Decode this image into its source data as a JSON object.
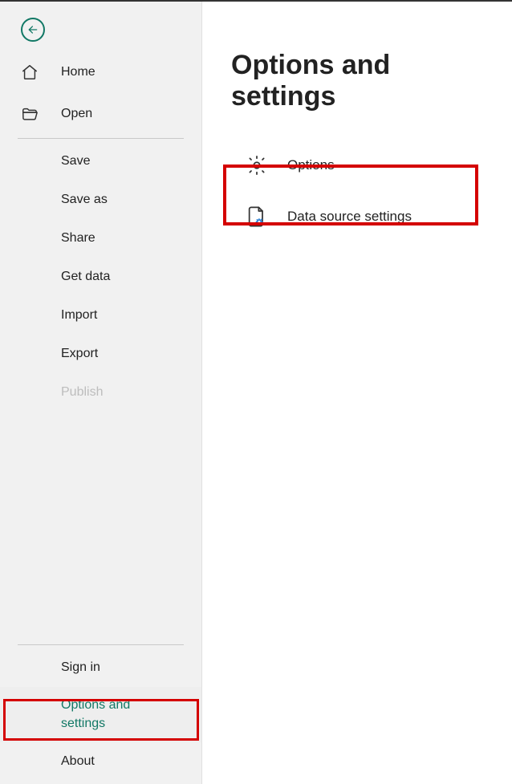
{
  "sidebar": {
    "top": [
      {
        "label": "Home"
      },
      {
        "label": "Open"
      }
    ],
    "file": [
      {
        "label": "Save"
      },
      {
        "label": "Save as"
      },
      {
        "label": "Share"
      },
      {
        "label": "Get data"
      },
      {
        "label": "Import"
      },
      {
        "label": "Export"
      },
      {
        "label": "Publish",
        "disabled": true
      }
    ],
    "bottom": [
      {
        "label": "Sign in"
      },
      {
        "label": "Options and settings",
        "active": true
      },
      {
        "label": "About"
      }
    ]
  },
  "main": {
    "title": "Options and settings",
    "items": [
      {
        "label": "Options"
      },
      {
        "label": "Data source settings"
      }
    ]
  }
}
